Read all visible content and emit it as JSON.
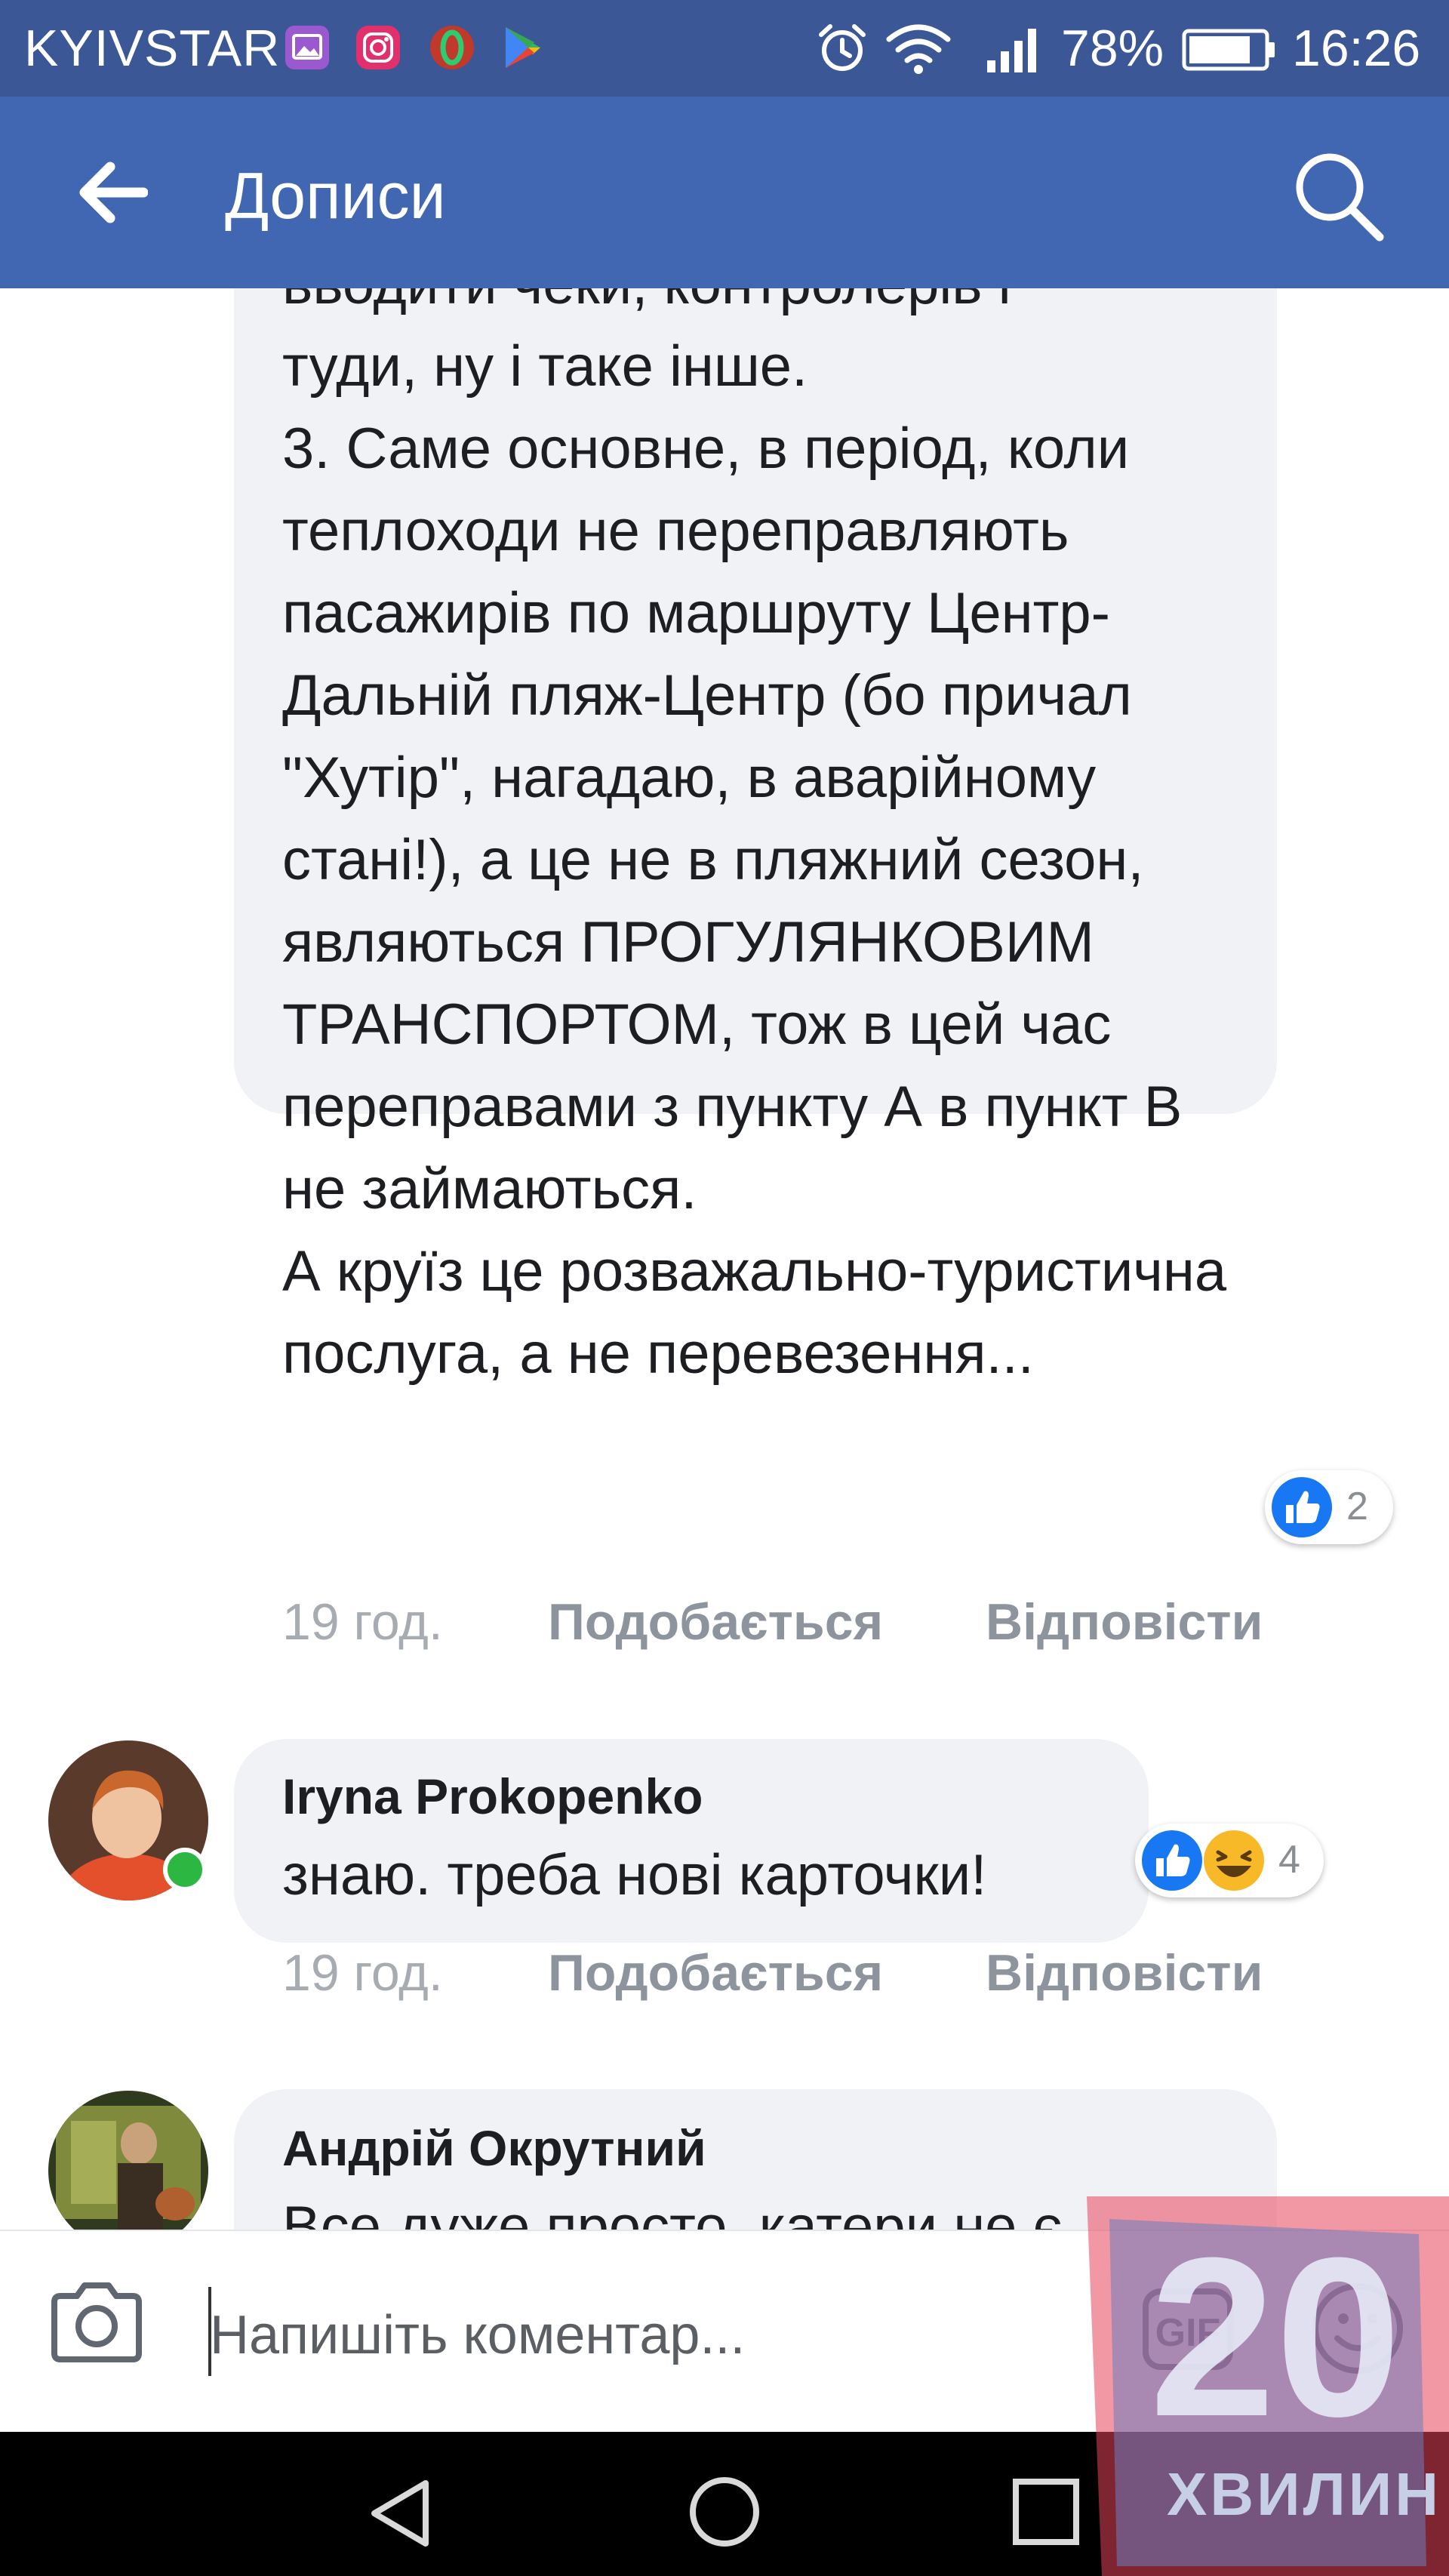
{
  "status_bar": {
    "carrier": "KYIVSTAR",
    "battery_percent": "78%",
    "time": "16:26",
    "icons": [
      "gallery-icon",
      "instagram-icon",
      "opera-icon",
      "play-store-icon",
      "alarm-icon",
      "wifi-icon",
      "signal-icon",
      "battery-icon"
    ]
  },
  "app_bar": {
    "title": "Дописи",
    "icons": [
      "back-arrow-icon",
      "search-icon"
    ]
  },
  "comments": [
    {
      "text": "вводити чеки, контролерів і\nтуди, ну і таке інше.\n3. Саме основне, в період, коли теплоходи не переправляють пасажирів по маршруту Центр-Дальній пляж-Центр (бо причал \"Хутір\", нагадаю, в аварійному стані!), а це не в пляжний сезон, являються ПРОГУЛЯНКОВИМ ТРАНСПОРТОМ, тож в цей час переправами з пункту А в пункт В не займаються.\nА круїз це розважально-туристична послуга, а не перевезення...",
      "time": "19 год.",
      "like_label": "Подобається",
      "reply_label": "Відповісти",
      "reactions": [
        "like-icon"
      ],
      "reaction_count": "2"
    },
    {
      "author": "Iryna Prokopenko",
      "text": "знаю. треба нові карточки!",
      "time": "19 год.",
      "like_label": "Подобається",
      "reply_label": "Відповісти",
      "reactions": [
        "like-icon",
        "haha-icon"
      ],
      "reaction_count": "4",
      "online": true
    },
    {
      "author": "Андрій Окрутний",
      "text": "Все дуже просто, катери не є"
    }
  ],
  "composer": {
    "placeholder": "Напишіть коментар...",
    "icons": [
      "camera-icon",
      "gif-icon",
      "emoji-icon"
    ]
  },
  "nav_bar": {
    "icons": [
      "nav-back-icon",
      "nav-home-icon",
      "nav-recents-icon"
    ]
  },
  "watermark": {
    "number": "20",
    "word": "ХВИЛИН"
  },
  "colors": {
    "status_bar": "#3b5795",
    "app_bar": "#4267b2",
    "bubble": "#f1f2f6",
    "like_blue": "#1877f2",
    "online_green": "#2cb742"
  }
}
